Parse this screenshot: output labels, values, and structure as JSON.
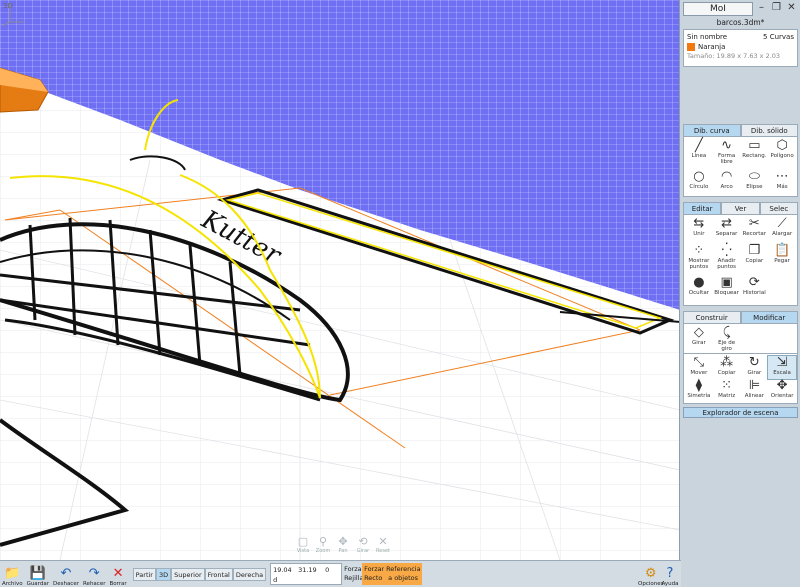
{
  "viewport": {
    "label": "3D",
    "grid_color": "#6f6ff4"
  },
  "view_tools": [
    {
      "icon": "frame-icon",
      "label": "Vista"
    },
    {
      "icon": "zoom-icon",
      "label": "Zoom"
    },
    {
      "icon": "pan-icon",
      "label": "Pan"
    },
    {
      "icon": "orbit-icon",
      "label": "Girar"
    },
    {
      "icon": "reset-icon",
      "label": "Reset"
    }
  ],
  "sketch_text": "Kutter",
  "app": {
    "title": "MoI",
    "filename": "barcos.3dm*"
  },
  "info": {
    "object_name": "Sin nombre",
    "count": "5 Curvas",
    "layer": "Naranja",
    "size": "Tamaño: 19.89 x 7.63 x 2.03",
    "layer_color": "#f07a10"
  },
  "draw_tabs": [
    "Dib. curva",
    "Dib. sólido"
  ],
  "draw_tools": [
    {
      "icon": "line-icon",
      "label": "Línea",
      "glyph": "╱"
    },
    {
      "icon": "freeform-icon",
      "label": "Forma libre",
      "glyph": "∿"
    },
    {
      "icon": "rectangle-icon",
      "label": "Rectang.",
      "glyph": "▭"
    },
    {
      "icon": "polygon-icon",
      "label": "Polígono",
      "glyph": "⬡"
    },
    {
      "icon": "circle-icon",
      "label": "Círculo",
      "glyph": "○"
    },
    {
      "icon": "arc-icon",
      "label": "Arco",
      "glyph": "◠"
    },
    {
      "icon": "ellipse-icon",
      "label": "Elipse",
      "glyph": "⬭"
    },
    {
      "icon": "more-icon",
      "label": "Más",
      "glyph": "⋯"
    }
  ],
  "edit_tabs": [
    "Editar",
    "Ver",
    "Selec"
  ],
  "edit_tools": [
    {
      "icon": "join-icon",
      "label": "Unir",
      "glyph": "⇆"
    },
    {
      "icon": "separate-icon",
      "label": "Separar",
      "glyph": "⇄"
    },
    {
      "icon": "trim-icon",
      "label": "Recortar",
      "glyph": "✂"
    },
    {
      "icon": "extend-icon",
      "label": "Alargar",
      "glyph": "⟋"
    },
    {
      "icon": "show-points-icon",
      "label": "Mostrar puntos",
      "glyph": "⁘"
    },
    {
      "icon": "add-points-icon",
      "label": "Añadir puntos",
      "glyph": "⁛"
    },
    {
      "icon": "copy-icon",
      "label": "Copiar",
      "glyph": "❐"
    },
    {
      "icon": "paste-icon",
      "label": "Pegar",
      "glyph": "📋"
    },
    {
      "icon": "hide-icon",
      "label": "Ocultar",
      "glyph": "●"
    },
    {
      "icon": "lock-icon",
      "label": "Bloquear",
      "glyph": "▣"
    },
    {
      "icon": "history-icon",
      "label": "Historial",
      "glyph": "⟳"
    }
  ],
  "transform_tabs": [
    "Construir",
    "Modificar"
  ],
  "transform_top": [
    {
      "icon": "rotate-icon",
      "label": "Girar",
      "glyph": "◇"
    },
    {
      "icon": "rotate-axis-icon",
      "label": "Eje de giro",
      "glyph": "⤹"
    }
  ],
  "transform_tools": [
    {
      "icon": "move-icon",
      "label": "Mover",
      "glyph": "⤡"
    },
    {
      "icon": "copy-transform-icon",
      "label": "Copiar",
      "glyph": "⁂"
    },
    {
      "icon": "rotate2-icon",
      "label": "Girar",
      "glyph": "↻"
    },
    {
      "icon": "scale-icon",
      "label": "Escala",
      "glyph": "⇲"
    },
    {
      "icon": "mirror-icon",
      "label": "Simetría",
      "glyph": "⧫"
    },
    {
      "icon": "array-icon",
      "label": "Matriz",
      "glyph": "⁙"
    },
    {
      "icon": "align-icon",
      "label": "Alinear",
      "glyph": "⊫"
    },
    {
      "icon": "orient-icon",
      "label": "Orientar",
      "glyph": "✥"
    }
  ],
  "explorer_label": "Explorador de escena",
  "bottom": {
    "file_buttons": [
      {
        "icon": "folder-icon",
        "label": "Archivo",
        "glyph": "📁"
      },
      {
        "icon": "save-icon",
        "label": "Guardar",
        "glyph": "💾"
      },
      {
        "icon": "undo-icon",
        "label": "Deshacer",
        "glyph": "↶"
      },
      {
        "icon": "redo-icon",
        "label": "Rehacer",
        "glyph": "↷"
      },
      {
        "icon": "delete-icon",
        "label": "Borrar",
        "glyph": "✕"
      }
    ],
    "views": [
      "Partir",
      "3D",
      "Superior",
      "Frontal",
      "Derecha"
    ],
    "active_view": "3D",
    "coords": {
      "x": "19.04",
      "y": "31.19",
      "z": "0",
      "d": "d"
    },
    "snap_labels": [
      "Forzar Rejilla",
      "Forzar Recto",
      "Referencia a objetos"
    ],
    "options_label": "Opciones",
    "help_label": "Ayuda"
  }
}
